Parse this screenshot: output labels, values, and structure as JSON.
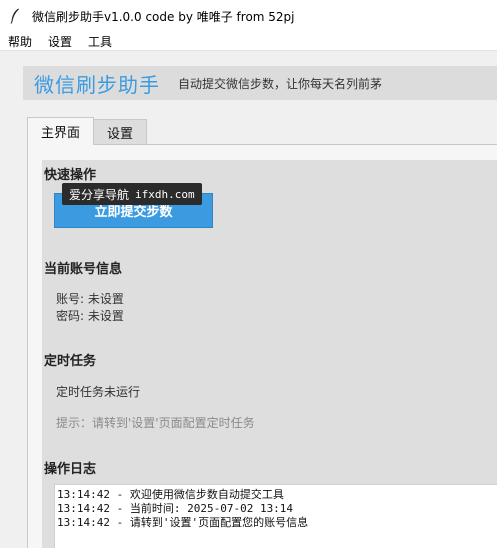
{
  "window": {
    "title": "微信刷步助手v1.0.0 code by 唯唯子 from 52pj",
    "icon": "feather-icon"
  },
  "menu": [
    "帮助",
    "设置",
    "工具"
  ],
  "header": {
    "app_name": "微信刷步助手",
    "slogan": "自动提交微信步数，让你每天名列前茅",
    "accent_color": "#3c9be0"
  },
  "tabs": [
    {
      "label": "主界面",
      "active": true
    },
    {
      "label": "设置",
      "active": false
    }
  ],
  "quick_actions": {
    "title": "快速操作",
    "submit_label": "立即提交步数"
  },
  "account": {
    "title": "当前账号信息",
    "account_line": "账号: 未设置",
    "password_line": "密码: 未设置"
  },
  "schedule": {
    "title": "定时任务",
    "status": "定时任务未运行",
    "hint": "提示：请转到'设置'页面配置定时任务"
  },
  "tooltip": {
    "text": "爱分享导航",
    "url": "ifxdh.com"
  },
  "log": {
    "title": "操作日志",
    "lines": [
      "13:14:42 - 欢迎使用微信步数自动提交工具",
      "13:14:42 - 当前时间: 2025-07-02 13:14",
      "13:14:42 - 请转到'设置'页面配置您的账号信息"
    ]
  }
}
